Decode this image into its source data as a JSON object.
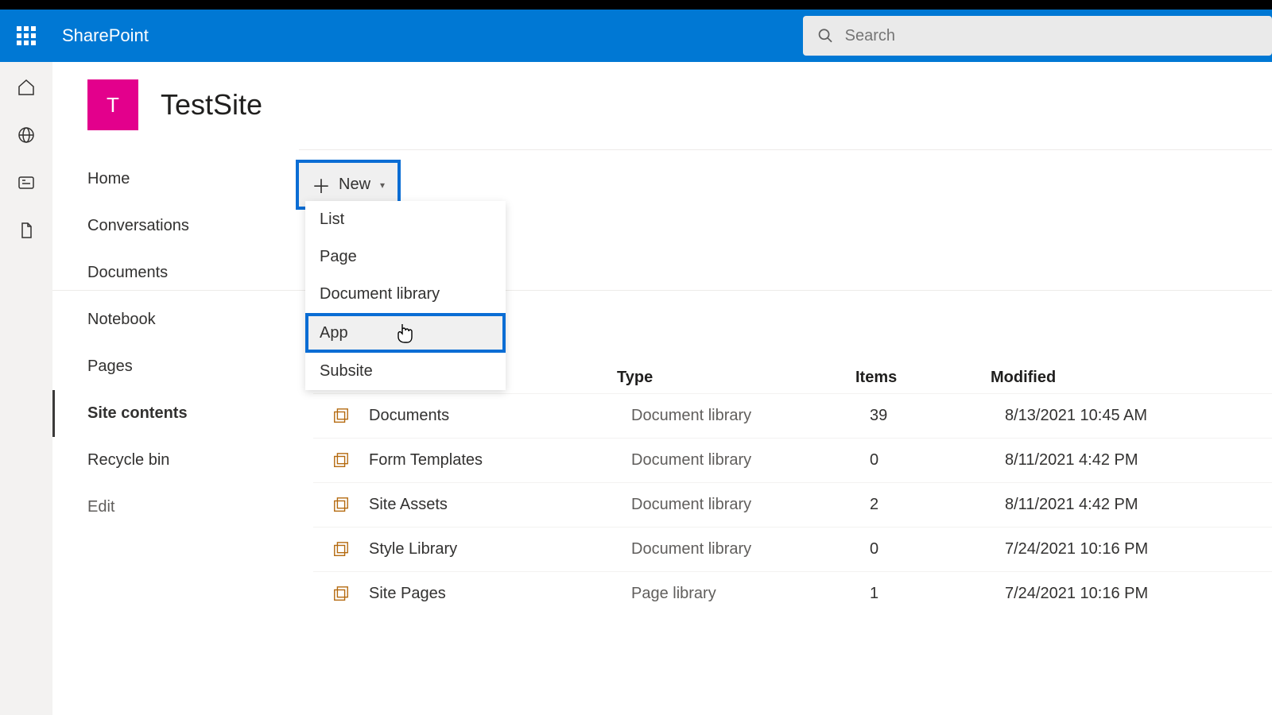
{
  "suite": {
    "app_name": "SharePoint"
  },
  "search": {
    "placeholder": "Search"
  },
  "site": {
    "logo_letter": "T",
    "title": "TestSite"
  },
  "side_nav": {
    "items": [
      {
        "label": "Home",
        "active": false
      },
      {
        "label": "Conversations",
        "active": false
      },
      {
        "label": "Documents",
        "active": false
      },
      {
        "label": "Notebook",
        "active": false
      },
      {
        "label": "Pages",
        "active": false
      },
      {
        "label": "Site contents",
        "active": true
      },
      {
        "label": "Recycle bin",
        "active": false
      }
    ],
    "edit_label": "Edit"
  },
  "command_bar": {
    "new_label": "New"
  },
  "new_dropdown": {
    "items": [
      {
        "label": "List",
        "highlighted": false
      },
      {
        "label": "Page",
        "highlighted": false
      },
      {
        "label": "Document library",
        "highlighted": false
      },
      {
        "label": "App",
        "highlighted": true
      },
      {
        "label": "Subsite",
        "highlighted": false
      }
    ]
  },
  "contents": {
    "headers": {
      "type": "Type",
      "items": "Items",
      "modified": "Modified"
    },
    "rows": [
      {
        "name": "Documents",
        "type": "Document library",
        "items": "39",
        "modified": "8/13/2021 10:45 AM"
      },
      {
        "name": "Form Templates",
        "type": "Document library",
        "items": "0",
        "modified": "8/11/2021 4:42 PM"
      },
      {
        "name": "Site Assets",
        "type": "Document library",
        "items": "2",
        "modified": "8/11/2021 4:42 PM"
      },
      {
        "name": "Style Library",
        "type": "Document library",
        "items": "0",
        "modified": "7/24/2021 10:16 PM"
      },
      {
        "name": "Site Pages",
        "type": "Page library",
        "items": "1",
        "modified": "7/24/2021 10:16 PM"
      }
    ]
  }
}
